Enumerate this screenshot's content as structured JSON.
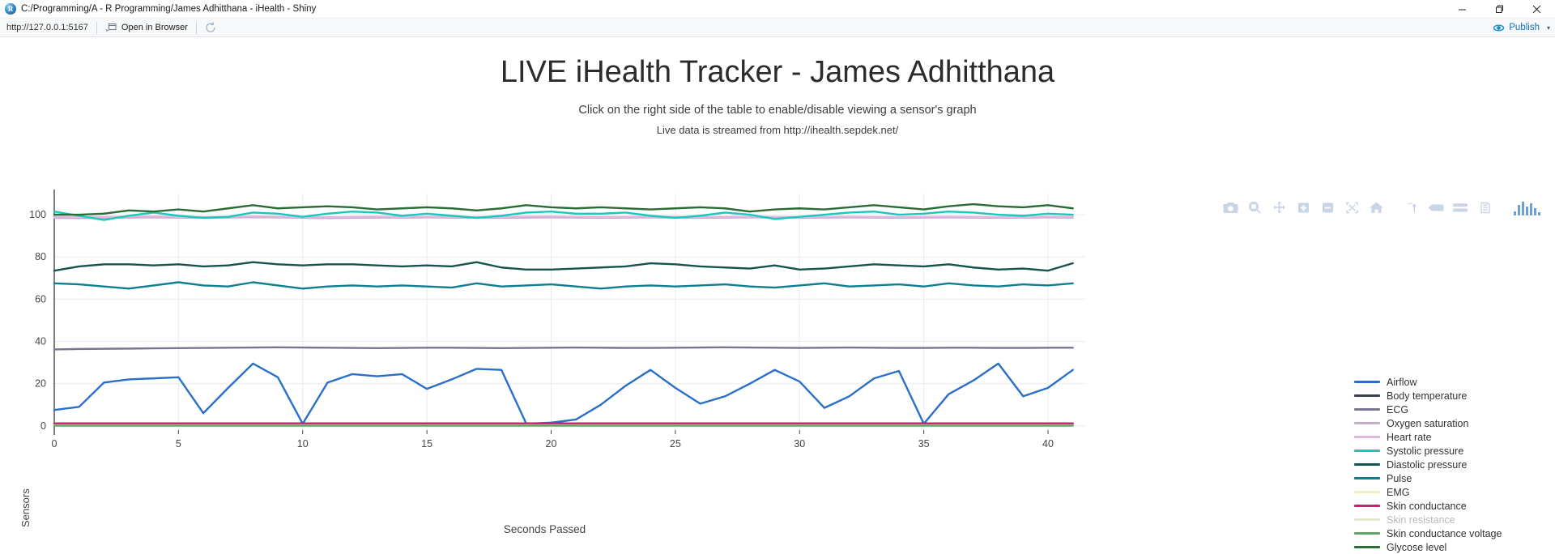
{
  "window": {
    "app_icon": "r-studio-icon",
    "title": "C:/Programming/A - R Programming/James Adhitthana - iHealth - Shiny",
    "minimize_label": "—",
    "maximize_label": "❐",
    "close_label": "✕"
  },
  "toolbar": {
    "url": "http://127.0.0.1:5167",
    "open_in_browser_label": "Open in Browser",
    "refresh_icon": "refresh-icon",
    "publish_label": "Publish",
    "publish_caret": "▾",
    "accent": "#1072b8"
  },
  "header": {
    "title": "LIVE iHealth Tracker - James Adhitthana",
    "subtitle": "Click on the right side of the table to enable/disable viewing a sensor's graph",
    "source_note": "Live data is streamed from http://ihealth.sepdek.net/"
  },
  "modebar": {
    "buttons": [
      {
        "name": "camera-icon",
        "title": "Download plot as a png"
      },
      {
        "name": "zoom-icon",
        "title": "Zoom"
      },
      {
        "name": "pan-icon",
        "title": "Pan"
      },
      {
        "name": "zoom-in-icon",
        "title": "Zoom in"
      },
      {
        "name": "zoom-out-icon",
        "title": "Zoom out"
      },
      {
        "name": "autoscale-icon",
        "title": "Autoscale"
      },
      {
        "name": "home-icon",
        "title": "Reset axes"
      },
      {
        "name": "spike-lines-icon",
        "title": "Toggle Spike Lines"
      },
      {
        "name": "hover-closest-icon",
        "title": "Show closest data on hover"
      },
      {
        "name": "hover-compare-icon",
        "title": "Compare data on hover"
      },
      {
        "name": "toggle-orientation-icon",
        "title": "Toggle orientation"
      },
      {
        "name": "plotly-logo-icon",
        "title": "Produced with Plotly"
      }
    ]
  },
  "chart_data": {
    "type": "line",
    "title": "",
    "xlabel": "Seconds Passed",
    "ylabel": "Sensors",
    "xlim": [
      0,
      41.5
    ],
    "ylim": [
      -2,
      110
    ],
    "xticks": [
      0,
      5,
      10,
      15,
      20,
      25,
      30,
      35,
      40
    ],
    "yticks": [
      0,
      20,
      40,
      60,
      80,
      100
    ],
    "grid": true,
    "legend_position": "right",
    "x": [
      0,
      1,
      2,
      3,
      4,
      5,
      6,
      7,
      8,
      9,
      10,
      11,
      12,
      13,
      14,
      15,
      16,
      17,
      18,
      19,
      20,
      21,
      22,
      23,
      24,
      25,
      26,
      27,
      28,
      29,
      30,
      31,
      32,
      33,
      34,
      35,
      36,
      37,
      38,
      39,
      40,
      41
    ],
    "series": [
      {
        "name": "Airflow",
        "color": "#2a6fc9",
        "visible": true,
        "values": [
          7.5,
          9,
          20.5,
          22,
          22.5,
          23,
          6,
          18,
          29.5,
          23,
          1,
          20.5,
          24.5,
          23.5,
          24.5,
          17.5,
          22,
          27,
          26.5,
          1,
          1.5,
          3,
          10,
          19,
          26.5,
          18,
          10.5,
          14,
          20,
          26.5,
          21,
          8.5,
          14,
          22.5,
          26,
          1,
          15,
          21.5,
          29.5,
          14,
          18,
          26.5
        ]
      },
      {
        "name": "Body temperature",
        "color": "#35414f",
        "visible": true,
        "values": [
          0.8,
          0.8,
          0.8,
          0.8,
          0.8,
          0.8,
          0.8,
          0.8,
          0.8,
          0.8,
          0.8,
          0.8,
          0.8,
          0.8,
          0.8,
          0.8,
          0.8,
          0.8,
          0.8,
          0.8,
          0.8,
          0.8,
          0.8,
          0.8,
          0.8,
          0.8,
          0.8,
          0.8,
          0.8,
          0.8,
          0.8,
          0.8,
          0.8,
          0.8,
          0.8,
          0.8,
          0.8,
          0.8,
          0.8,
          0.8,
          0.8,
          0.8
        ]
      },
      {
        "name": "ECG",
        "color": "#7b7490",
        "visible": true,
        "values": [
          36.2,
          36.4,
          36.5,
          36.6,
          36.7,
          36.8,
          36.9,
          37.0,
          37.1,
          37.2,
          37.1,
          37.0,
          36.9,
          36.8,
          36.9,
          37.0,
          37.0,
          36.9,
          36.8,
          36.9,
          37.0,
          37.1,
          37.0,
          36.9,
          36.9,
          37.0,
          37.1,
          37.2,
          37.1,
          37.0,
          36.9,
          37.0,
          37.1,
          37.0,
          36.9,
          36.9,
          37.0,
          37.0,
          36.9,
          36.9,
          37.0,
          37.0
        ]
      },
      {
        "name": "Oxygen saturation",
        "color": "#c9a8d4",
        "visible": true,
        "values": [
          98.5,
          98.4,
          98.5,
          98.6,
          98.7,
          98.6,
          98.5,
          98.6,
          98.8,
          98.7,
          98.5,
          98.4,
          98.5,
          98.6,
          98.6,
          98.7,
          98.6,
          98.5,
          98.5,
          98.6,
          98.7,
          98.6,
          98.5,
          98.6,
          98.7,
          98.6,
          98.5,
          98.6,
          98.7,
          98.6,
          98.5,
          98.6,
          98.7,
          98.6,
          98.5,
          98.6,
          98.7,
          98.6,
          98.5,
          98.6,
          98.7,
          98.6
        ]
      },
      {
        "name": "Heart rate",
        "color": "#dfb8dc",
        "visible": true,
        "values": [
          99.0,
          98.9,
          99.0,
          99.1,
          99.2,
          99.0,
          98.9,
          99.0,
          99.2,
          99.1,
          98.9,
          98.8,
          99.0,
          99.1,
          99.0,
          99.1,
          99.0,
          98.9,
          99.0,
          99.1,
          99.2,
          99.0,
          98.9,
          99.0,
          99.1,
          99.0,
          98.9,
          99.0,
          99.1,
          99.0,
          98.9,
          99.0,
          99.1,
          99.0,
          98.9,
          99.0,
          99.1,
          99.0,
          98.9,
          99.0,
          99.1,
          99.0
        ]
      },
      {
        "name": "Systolic pressure",
        "color": "#17c8bd",
        "visible": true,
        "values": [
          101.5,
          99.5,
          97.5,
          99.5,
          101.0,
          99.5,
          98.5,
          99.0,
          101.0,
          100.5,
          99.0,
          100.5,
          101.5,
          101.0,
          99.5,
          100.5,
          99.5,
          98.5,
          99.5,
          101.0,
          101.5,
          100.5,
          100.5,
          101.0,
          99.5,
          98.5,
          99.5,
          101.0,
          100.0,
          98.0,
          99.0,
          100.0,
          101.0,
          101.5,
          100.0,
          100.5,
          101.5,
          101.0,
          100.0,
          99.5,
          100.5,
          100.0
        ]
      },
      {
        "name": "Diastolic pressure",
        "color": "#17544f",
        "visible": true,
        "values": [
          73.5,
          75.5,
          76.5,
          76.5,
          76.0,
          76.5,
          75.5,
          76.0,
          77.5,
          76.5,
          76.0,
          76.5,
          76.5,
          76.0,
          75.5,
          76.0,
          75.5,
          77.5,
          75.0,
          74.0,
          74.0,
          74.5,
          75.0,
          75.5,
          77.0,
          76.5,
          75.5,
          75.0,
          74.5,
          76.0,
          74.0,
          74.5,
          75.5,
          76.5,
          76.0,
          75.5,
          76.5,
          75.0,
          74.0,
          74.5,
          73.5,
          77.0
        ]
      },
      {
        "name": "Pulse",
        "color": "#0e7f91",
        "visible": true,
        "values": [
          67.5,
          67.0,
          66.0,
          65.0,
          66.5,
          68.0,
          66.5,
          66.0,
          68.0,
          66.5,
          65.0,
          66.0,
          66.5,
          66.0,
          66.5,
          66.0,
          65.5,
          67.5,
          66.0,
          66.5,
          67.0,
          66.0,
          65.0,
          66.0,
          66.5,
          66.0,
          66.5,
          67.0,
          66.0,
          65.5,
          66.5,
          67.5,
          66.0,
          66.5,
          67.0,
          66.0,
          67.5,
          66.5,
          66.0,
          67.0,
          66.5,
          67.5
        ]
      },
      {
        "name": "EMG",
        "color": "#eeeec4",
        "visible": true,
        "values": [
          0.4,
          0.4,
          0.4,
          0.4,
          0.4,
          0.4,
          0.4,
          0.4,
          0.4,
          0.4,
          0.4,
          0.4,
          0.4,
          0.4,
          0.4,
          0.4,
          0.4,
          0.4,
          0.4,
          0.4,
          0.4,
          0.4,
          0.4,
          0.4,
          0.4,
          0.4,
          0.4,
          0.4,
          0.4,
          0.4,
          0.4,
          0.4,
          0.4,
          0.4,
          0.4,
          0.4,
          0.4,
          0.4,
          0.4,
          0.4,
          0.4,
          0.4
        ]
      },
      {
        "name": "Skin conductance",
        "color": "#c4216e",
        "visible": true,
        "values": [
          1.2,
          1.2,
          1.2,
          1.2,
          1.2,
          1.2,
          1.2,
          1.2,
          1.2,
          1.2,
          1.2,
          1.2,
          1.2,
          1.2,
          1.2,
          1.2,
          1.2,
          1.2,
          1.2,
          1.2,
          1.2,
          1.2,
          1.2,
          1.2,
          1.2,
          1.2,
          1.2,
          1.2,
          1.2,
          1.2,
          1.2,
          1.2,
          1.2,
          1.2,
          1.2,
          1.2,
          1.2,
          1.2,
          1.2,
          1.2,
          1.2,
          1.2
        ]
      },
      {
        "name": "Skin resistance",
        "color": "#e4e8cc",
        "visible": false,
        "values": [
          0.2,
          0.2,
          0.2,
          0.2,
          0.2,
          0.2,
          0.2,
          0.2,
          0.2,
          0.2,
          0.2,
          0.2,
          0.2,
          0.2,
          0.2,
          0.2,
          0.2,
          0.2,
          0.2,
          0.2,
          0.2,
          0.2,
          0.2,
          0.2,
          0.2,
          0.2,
          0.2,
          0.2,
          0.2,
          0.2,
          0.2,
          0.2,
          0.2,
          0.2,
          0.2,
          0.2,
          0.2,
          0.2,
          0.2,
          0.2,
          0.2,
          0.2
        ]
      },
      {
        "name": "Skin conductance voltage",
        "color": "#5aa85e",
        "visible": true,
        "values": [
          0.1,
          0.1,
          0.1,
          0.1,
          0.1,
          0.1,
          0.1,
          0.1,
          0.1,
          0.1,
          0.1,
          0.1,
          0.1,
          0.1,
          0.1,
          0.1,
          0.1,
          0.1,
          0.1,
          0.1,
          0.1,
          0.1,
          0.1,
          0.1,
          0.1,
          0.1,
          0.1,
          0.1,
          0.1,
          0.1,
          0.1,
          0.1,
          0.1,
          0.1,
          0.1,
          0.1,
          0.1,
          0.1,
          0.1,
          0.1,
          0.1,
          0.1
        ]
      },
      {
        "name": "Glycose level",
        "color": "#2b6b36",
        "visible": true,
        "values": [
          100.0,
          100.0,
          100.5,
          102.0,
          101.5,
          102.5,
          101.5,
          103.0,
          104.5,
          103.0,
          103.5,
          104.0,
          103.5,
          102.5,
          103.0,
          103.5,
          103.0,
          102.0,
          103.0,
          104.5,
          103.5,
          103.0,
          103.5,
          103.0,
          102.5,
          103.0,
          103.5,
          103.0,
          101.5,
          102.5,
          103.0,
          102.5,
          103.5,
          104.5,
          103.5,
          102.5,
          104.0,
          105.0,
          104.0,
          103.5,
          104.5,
          103.0
        ]
      }
    ]
  }
}
